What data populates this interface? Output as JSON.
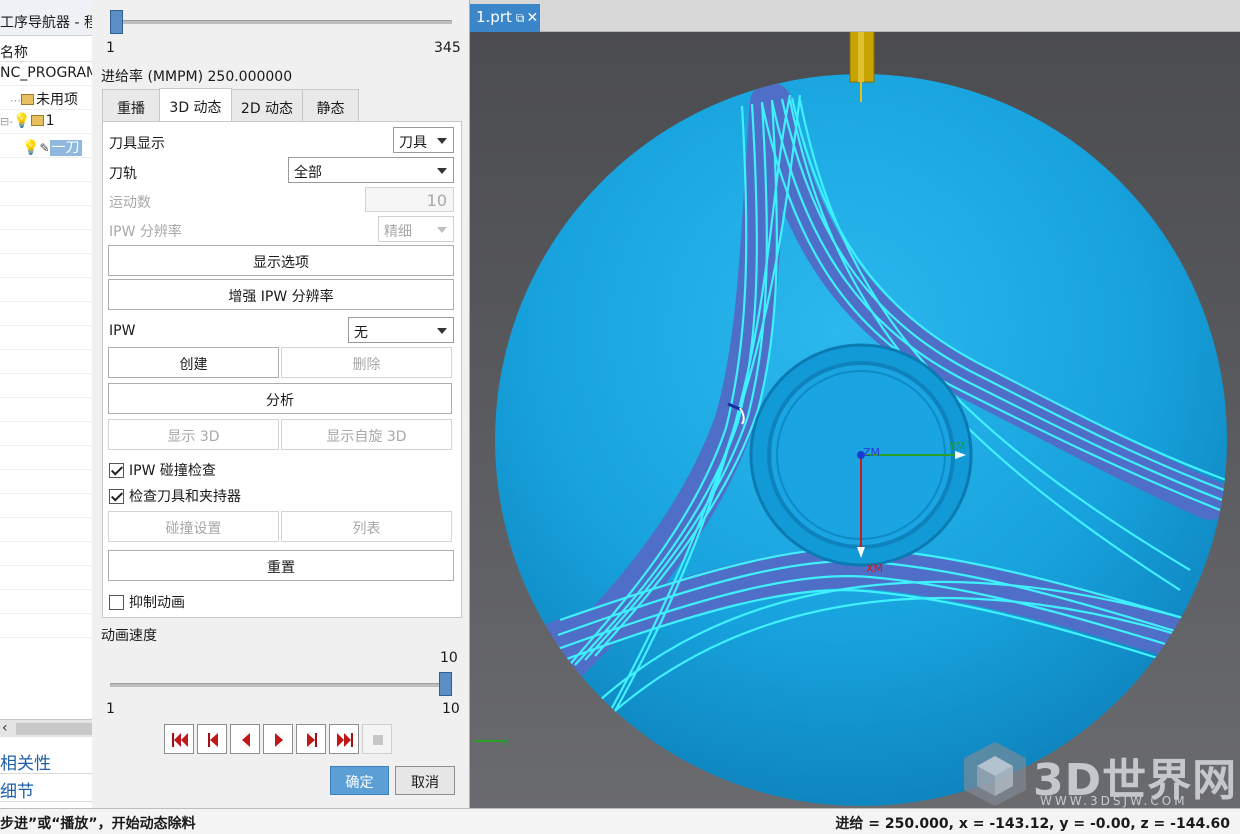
{
  "window": {
    "part_tab_label": "1.prt",
    "part_tab_icon": "restore-icon",
    "part_tab_close": "close-icon"
  },
  "navigator": {
    "title": "工序导航器 - 程",
    "column_header": "名称",
    "rows": [
      {
        "label": "NC_PROGRAM"
      },
      {
        "label": "未用项"
      },
      {
        "label": "1"
      },
      {
        "label": "一刀"
      }
    ],
    "sections": {
      "dependencies": "相关性",
      "details": "细节"
    }
  },
  "dialog": {
    "step_slider": {
      "min": "1",
      "max": "345",
      "value": 1
    },
    "feed_rate_label": "进给率 (MMPM) 250.000000",
    "tabs": [
      {
        "label": "重播"
      },
      {
        "label": "3D 动态",
        "active": true
      },
      {
        "label": "2D 动态"
      },
      {
        "label": "静态"
      }
    ],
    "tool_display": {
      "label": "刀具显示",
      "value": "刀具"
    },
    "toolpath": {
      "label": "刀轨",
      "value": "全部"
    },
    "motion_count": {
      "label": "运动数",
      "value": "10"
    },
    "ipw_resolution": {
      "label": "IPW 分辨率",
      "value": "精细"
    },
    "display_options_button": "显示选项",
    "enhance_ipw_button": "增强 IPW 分辨率",
    "ipw": {
      "label": "IPW",
      "value": "无"
    },
    "create_button": "创建",
    "delete_button": "删除",
    "analyze_button": "分析",
    "show3d_button": "显示 3D",
    "show_spin3d_button": "显示自旋 3D",
    "ipw_collision_check": {
      "label": "IPW 碰撞检查",
      "checked": true
    },
    "check_tool_holder": {
      "label": "检查刀具和夹持器",
      "checked": true
    },
    "collision_settings_button": "碰撞设置",
    "list_button": "列表",
    "reset_button": "重置",
    "suppress_animation": {
      "label": "抑制动画",
      "checked": false
    },
    "animation_speed": {
      "label": "动画速度",
      "value_text": "10",
      "min": "1",
      "max": "10",
      "value": 10
    },
    "playback_buttons": [
      {
        "name": "go-to-start-icon"
      },
      {
        "name": "step-back-icon"
      },
      {
        "name": "play-reverse-icon"
      },
      {
        "name": "play-icon"
      },
      {
        "name": "step-forward-icon"
      },
      {
        "name": "go-to-end-icon"
      },
      {
        "name": "stop-icon"
      }
    ],
    "ok_button": "确定",
    "cancel_button": "取消"
  },
  "viewport": {
    "axis_labels": {
      "zm": "ZM",
      "ym": "YM",
      "xm": "XM",
      "y": "Y"
    },
    "colors": {
      "part": "#1fa6e0",
      "toolpath": "#3ff0ff",
      "band": "#4f6ec8",
      "background": "#55565a"
    }
  },
  "watermark": {
    "text": "3D世界网",
    "url": "WWW.3DSJW.COM"
  },
  "status": {
    "left": "步进”或“播放”，开始动态除料",
    "right": "进给 = 250.000, x = -143.12, y = -0.00, z = -144.60"
  }
}
